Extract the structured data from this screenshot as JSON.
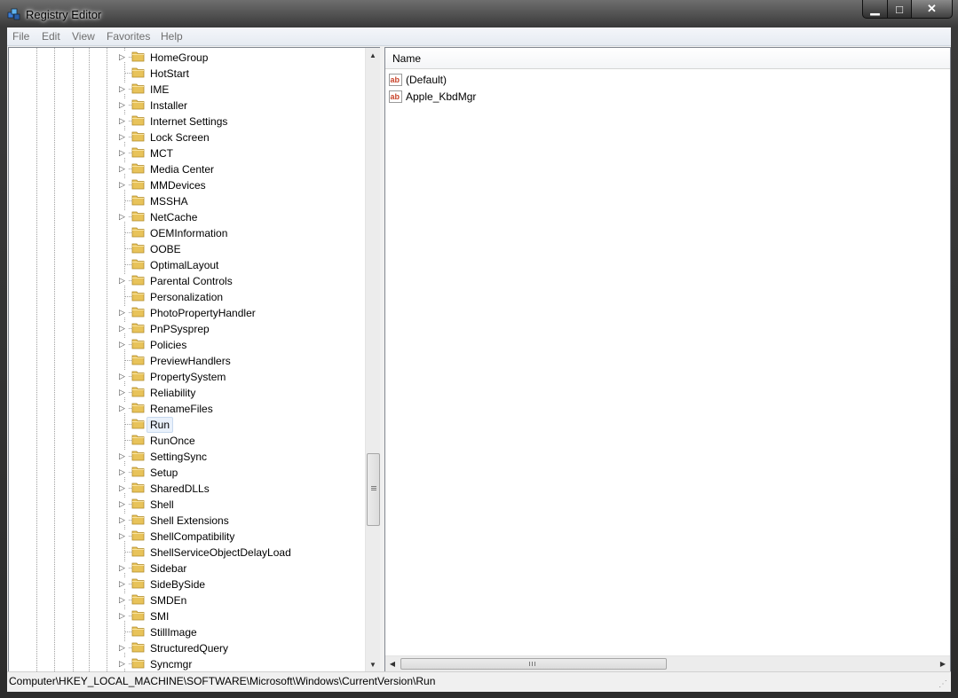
{
  "window": {
    "title": "Registry Editor"
  },
  "menu": [
    "File",
    "Edit",
    "View",
    "Favorites",
    "Help"
  ],
  "tree": {
    "items": [
      {
        "label": "HomeGroup",
        "expandable": true
      },
      {
        "label": "HotStart",
        "expandable": false
      },
      {
        "label": "IME",
        "expandable": true
      },
      {
        "label": "Installer",
        "expandable": true
      },
      {
        "label": "Internet Settings",
        "expandable": true
      },
      {
        "label": "Lock Screen",
        "expandable": true
      },
      {
        "label": "MCT",
        "expandable": true
      },
      {
        "label": "Media Center",
        "expandable": true
      },
      {
        "label": "MMDevices",
        "expandable": true
      },
      {
        "label": "MSSHA",
        "expandable": false
      },
      {
        "label": "NetCache",
        "expandable": true
      },
      {
        "label": "OEMInformation",
        "expandable": false
      },
      {
        "label": "OOBE",
        "expandable": false
      },
      {
        "label": "OptimalLayout",
        "expandable": false
      },
      {
        "label": "Parental Controls",
        "expandable": true
      },
      {
        "label": "Personalization",
        "expandable": false
      },
      {
        "label": "PhotoPropertyHandler",
        "expandable": true
      },
      {
        "label": "PnPSysprep",
        "expandable": true
      },
      {
        "label": "Policies",
        "expandable": true
      },
      {
        "label": "PreviewHandlers",
        "expandable": false
      },
      {
        "label": "PropertySystem",
        "expandable": true
      },
      {
        "label": "Reliability",
        "expandable": true
      },
      {
        "label": "RenameFiles",
        "expandable": true
      },
      {
        "label": "Run",
        "expandable": false,
        "selected": true
      },
      {
        "label": "RunOnce",
        "expandable": false
      },
      {
        "label": "SettingSync",
        "expandable": true
      },
      {
        "label": "Setup",
        "expandable": true
      },
      {
        "label": "SharedDLLs",
        "expandable": true
      },
      {
        "label": "Shell",
        "expandable": true
      },
      {
        "label": "Shell Extensions",
        "expandable": true
      },
      {
        "label": "ShellCompatibility",
        "expandable": true
      },
      {
        "label": "ShellServiceObjectDelayLoad",
        "expandable": false
      },
      {
        "label": "Sidebar",
        "expandable": true
      },
      {
        "label": "SideBySide",
        "expandable": true
      },
      {
        "label": "SMDEn",
        "expandable": true
      },
      {
        "label": "SMI",
        "expandable": true
      },
      {
        "label": "StillImage",
        "expandable": false
      },
      {
        "label": "StructuredQuery",
        "expandable": true
      },
      {
        "label": "Syncmgr",
        "expandable": true
      }
    ]
  },
  "list": {
    "columns": [
      "Name"
    ],
    "rows": [
      {
        "name": "(Default)",
        "icon": "string-value-icon"
      },
      {
        "name": "Apple_KbdMgr",
        "icon": "string-value-icon"
      }
    ]
  },
  "status": "Computer\\HKEY_LOCAL_MACHINE\\SOFTWARE\\Microsoft\\Windows\\CurrentVersion\\Run",
  "colors": {
    "selection": "#e9f1fb",
    "folder": "#e8c35a",
    "string_icon": "#c8452c"
  }
}
